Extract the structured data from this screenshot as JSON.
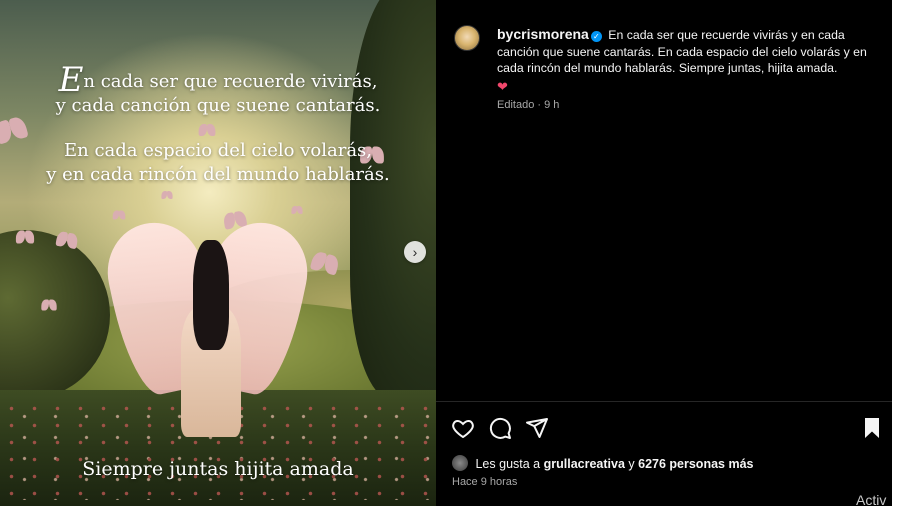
{
  "post": {
    "image": {
      "quote_line1_rest": "n cada ser que recuerde vivirás,",
      "quote_dropcap": "E",
      "quote_line2": "y cada canción que suene cantarás.",
      "quote_line3": "En cada espacio del cielo volarás,",
      "quote_line4": "y en cada rincón del mundo hablarás.",
      "quote_bottom": "Siempre juntas hijita amada"
    },
    "author": {
      "username": "bycrismorena",
      "verified": true
    },
    "caption": "En cada ser que recuerde vivirás y en cada canción que suene cantarás. En cada espacio del cielo volarás y en cada rincón del mundo hablarás. Siempre juntas, hijita amada.",
    "caption_emoji": "❤",
    "edited_label": "Editado · 9 h",
    "likes": {
      "prefix": "Les gusta a",
      "first_user": "grullacreativa",
      "connector": "y",
      "others": "6276 personas más"
    },
    "timestamp": "Hace 9 horas"
  },
  "colors": {
    "accent_blue": "#0095f6",
    "heart": "#f0476c",
    "panel_bg": "#000000",
    "muted_text": "#a8a8a8"
  },
  "icons": {
    "like": "heart-outline-icon",
    "comment": "comment-bubble-icon",
    "share": "paper-plane-icon",
    "save": "bookmark-filled-icon",
    "next": "chevron-right-icon"
  },
  "os_watermark": "Activ"
}
